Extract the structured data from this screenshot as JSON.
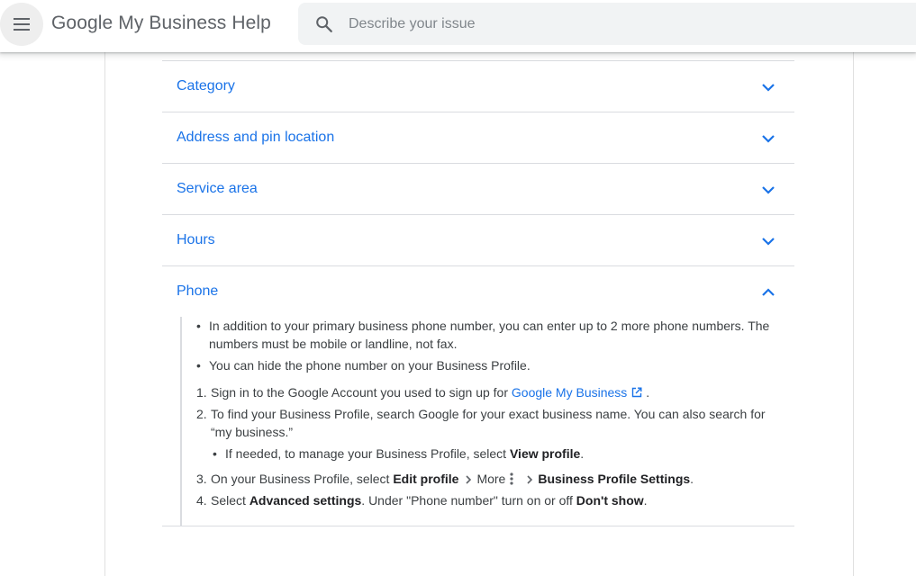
{
  "header": {
    "title": "Google My Business Help",
    "menu_icon": "hamburger-menu-icon",
    "search": {
      "placeholder": "Describe your issue",
      "value": "",
      "icon": "search-icon"
    }
  },
  "accordion": {
    "items": [
      {
        "title": "Category",
        "expanded": false
      },
      {
        "title": "Address and pin location",
        "expanded": false
      },
      {
        "title": "Service area",
        "expanded": false
      },
      {
        "title": "Hours",
        "expanded": false
      },
      {
        "title": "Phone",
        "expanded": true
      }
    ]
  },
  "phone": {
    "bullets": [
      "In addition to your primary business phone number, you can enter up to 2 more phone numbers. The numbers must be mobile or landline, not fax.",
      "You can hide the phone number on your Business Profile."
    ],
    "steps": {
      "s1": {
        "num": "1.",
        "text": "Sign in to the Google Account you used to sign up for",
        "link": "Google My Business",
        "end": "."
      },
      "s2": {
        "num": "2.",
        "text": "To find your Business Profile, search Google for your exact business name. You can also search for “my business.”",
        "sub_text": "If needed, to manage your Business Profile, select",
        "sub_bold": "View profile",
        "sub_end": "."
      },
      "s3": {
        "num": "3.",
        "text": "On your Business Profile, select",
        "bold1": "Edit profile",
        "more": "More",
        "bold2": "Business Profile Settings",
        "end": "."
      },
      "s4": {
        "num": "4.",
        "text": "Select",
        "bold1": "Advanced settings",
        "mid": ". Under \"Phone number\" turn on or off",
        "bold2": "Don't show",
        "end": "."
      }
    }
  },
  "colors": {
    "link": "#1a73e8",
    "text": "#3c4043",
    "divider": "#dadce0",
    "search_bg": "#f1f3f4"
  }
}
